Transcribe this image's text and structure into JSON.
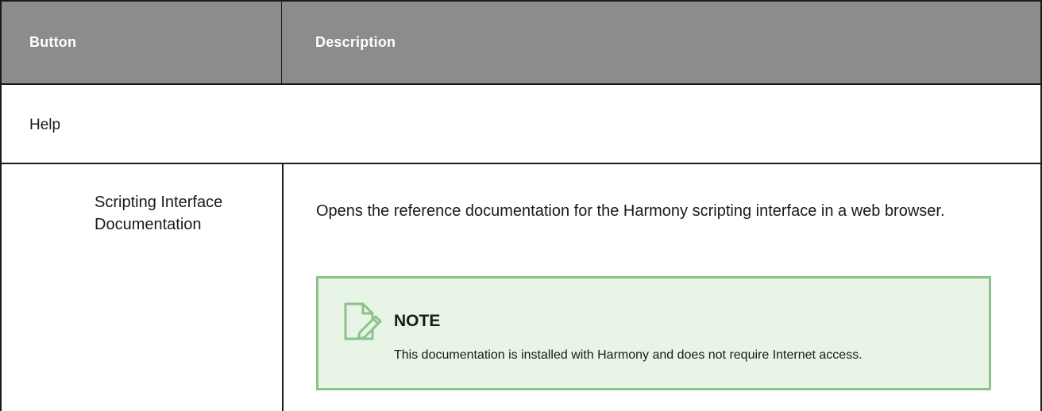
{
  "table": {
    "header": {
      "col1": "Button",
      "col2": "Description"
    },
    "section": "Help",
    "rows": [
      {
        "button": "Scripting Interface Documentation",
        "description": "Opens the reference documentation for the Harmony scripting interface in a web browser.",
        "note": {
          "icon": "note-icon",
          "title": "NOTE",
          "text": "This documentation is installed with Harmony and does not require Internet access."
        }
      }
    ]
  },
  "colors": {
    "header_bg": "#8c8c8c",
    "note_bg": "#e8f4e6",
    "note_border": "#8dc28a"
  }
}
